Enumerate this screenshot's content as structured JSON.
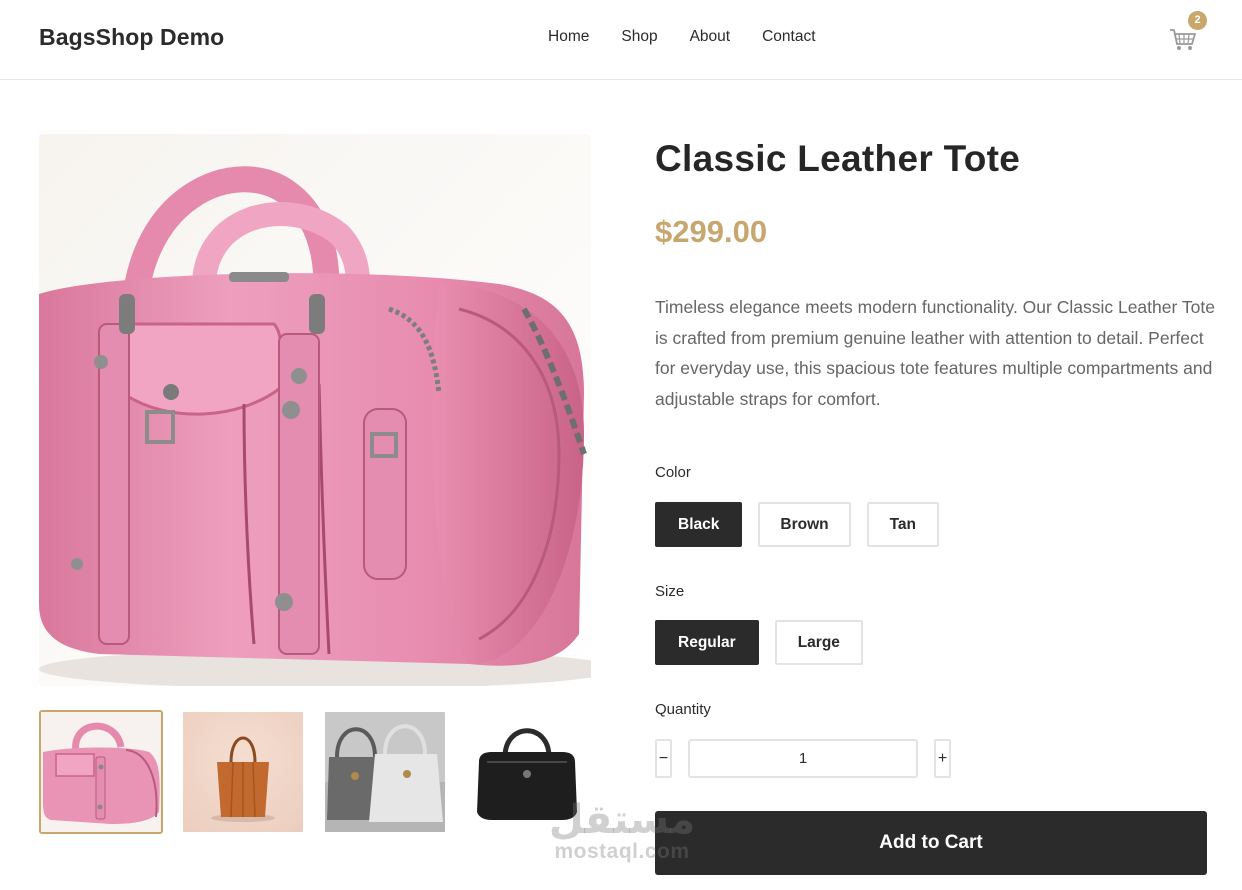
{
  "header": {
    "brand": "BagsShop Demo",
    "nav": [
      "Home",
      "Shop",
      "About",
      "Contact"
    ],
    "cart_icon": "cart-icon",
    "cart_count": "2"
  },
  "product": {
    "title": "Classic Leather Tote",
    "price": "$299.00",
    "description": "Timeless elegance meets modern functionality. Our Classic Leather Tote is crafted from premium genuine leather with attention to detail. Perfect for everyday use, this spacious tote features multiple compartments and adjustable straps for comfort."
  },
  "options": {
    "color_label": "Color",
    "colors": [
      "Black",
      "Brown",
      "Tan"
    ],
    "selected_color": "Black",
    "size_label": "Size",
    "sizes": [
      "Regular",
      "Large"
    ],
    "selected_size": "Regular",
    "quantity_label": "Quantity",
    "quantity_value": "1",
    "decrement": "−",
    "increment": "+"
  },
  "actions": {
    "add_to_cart": "Add to Cart"
  },
  "watermark": {
    "arabic": "مستقل",
    "latin": "mostaql.com"
  },
  "colors": {
    "accent": "#c9a66b",
    "dark": "#2b2b2b",
    "price": "#c7a670",
    "bag_pink": "#e79ab5"
  }
}
